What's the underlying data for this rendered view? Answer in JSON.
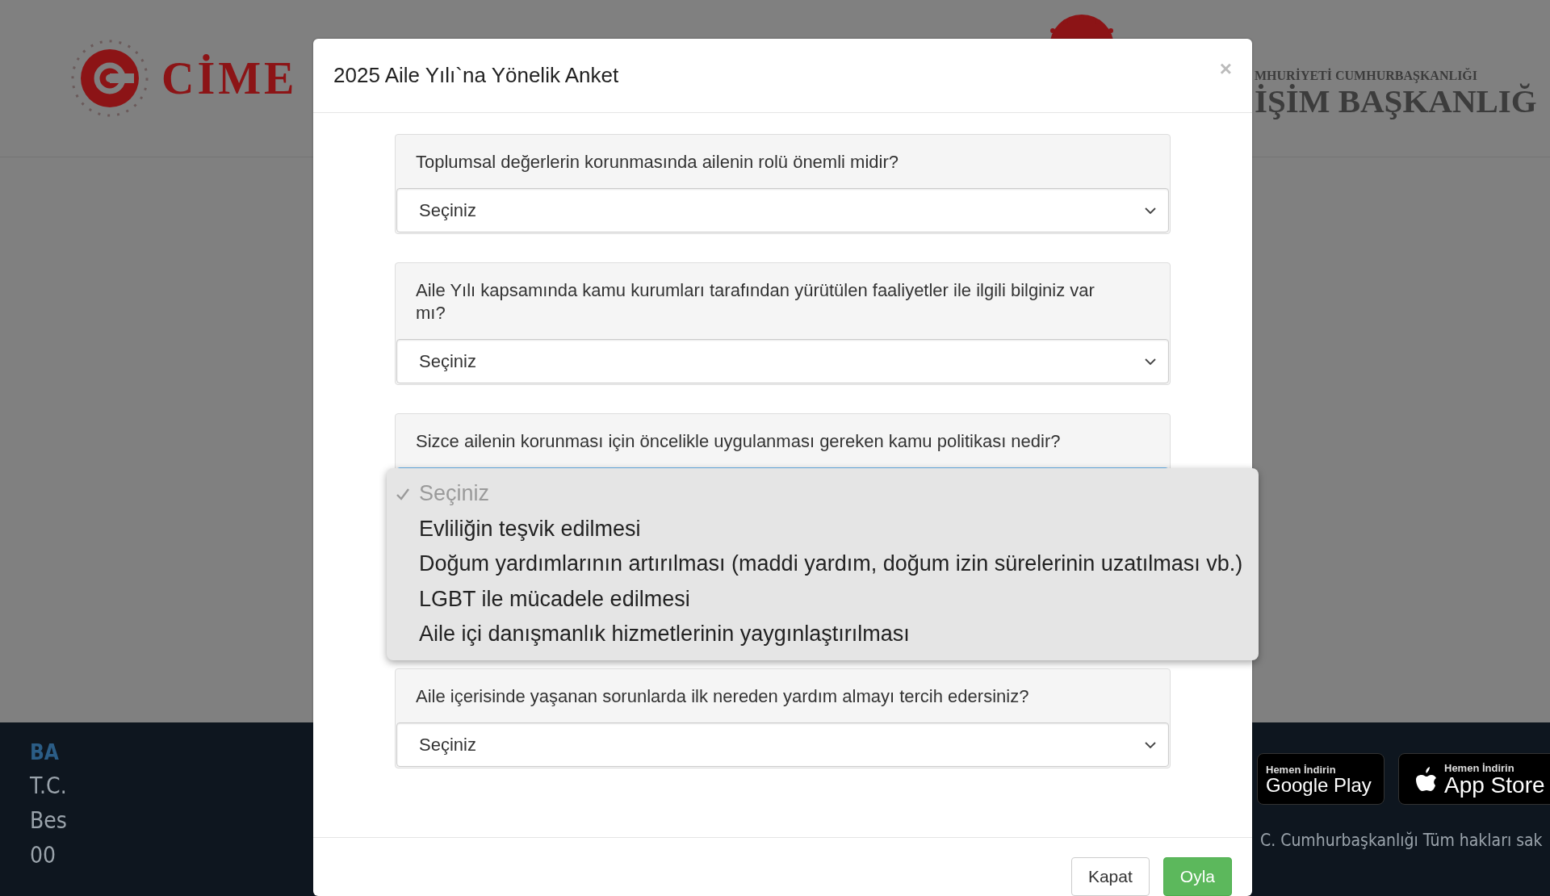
{
  "background": {
    "logo_text": "CİME",
    "header_line_1": "MHURİYETİ CUMHURBAŞKANLIĞI",
    "header_line_2": "İŞİM BAŞKANLIĞ",
    "footer_texts": [
      {
        "text": "BA",
        "kind": "heading"
      },
      {
        "text": "T.C.",
        "kind": "plain"
      },
      {
        "text": "Bes",
        "kind": "plain"
      },
      {
        "text": "00",
        "kind": "plain"
      }
    ],
    "store_buttons": [
      {
        "caption": "Hemen İndirin",
        "store": "Google Play",
        "kind": "google"
      },
      {
        "caption": "Hemen İndirin",
        "store": "App Store",
        "kind": "apple"
      }
    ],
    "copyright": "C. Cumhurbaşkanlığı Tüm hakları sak"
  },
  "modal": {
    "title": "2025 Aile Yılı`na Yönelik Anket",
    "close": "×",
    "questions": [
      {
        "question": "Toplumsal değerlerin korunmasında ailenin rolü önemli midir?",
        "value": "Seçiniz"
      },
      {
        "question": "Aile Yılı kapsamında kamu kurumları tarafından yürütülen faaliyetler ile ilgili bilginiz var mı?",
        "value": "Seçiniz"
      },
      {
        "question": "Sizce ailenin korunması için öncelikle uygulanması gereken kamu politikası nedir?",
        "options": [
          {
            "label": "Seçiniz",
            "selected": true
          },
          {
            "label": "Evliliğin teşvik edilmesi",
            "selected": false
          },
          {
            "label": "Doğum yardımlarının artırılması (maddi yardım, doğum izin sürelerinin uzatılması vb.)",
            "selected": false
          },
          {
            "label": "LGBT ile mücadele edilmesi",
            "selected": false
          },
          {
            "label": "Aile içi danışmanlık hizmetlerinin yaygınlaştırılması",
            "selected": false
          }
        ]
      },
      {
        "question": "Aile içerisinde yaşanan sorunlarda ilk nereden yardım almayı tercih edersiniz?",
        "value": "Seçiniz"
      }
    ],
    "buttons": [
      {
        "label": "Kapat",
        "kind": "default"
      },
      {
        "label": "Oyla",
        "kind": "primary"
      }
    ]
  }
}
